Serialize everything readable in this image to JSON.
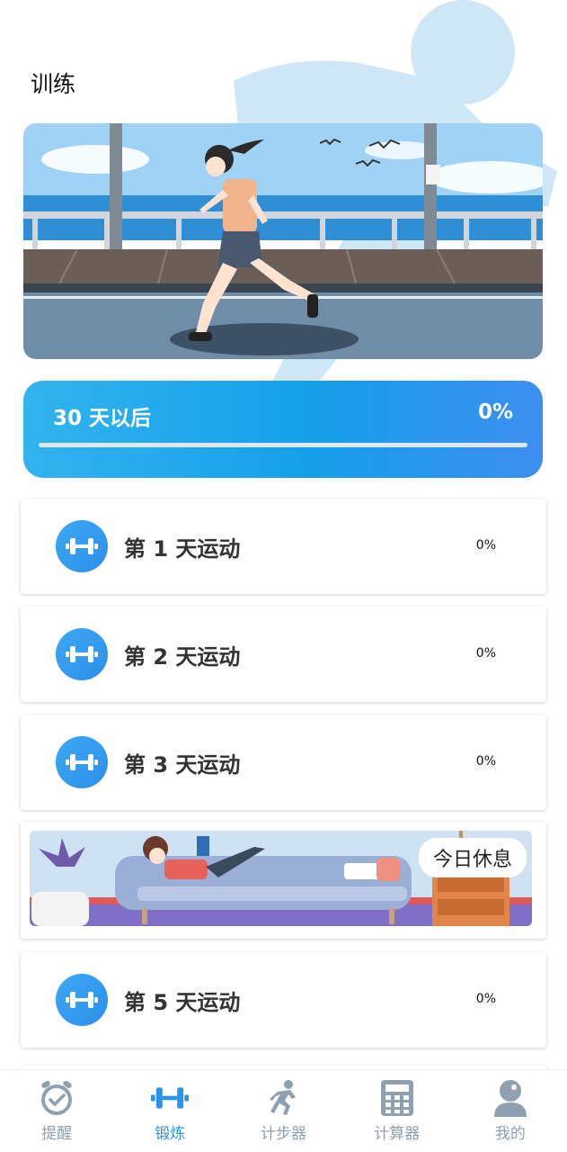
{
  "header": {
    "title": "训练"
  },
  "plan": {
    "label": "30 天以后",
    "percent_text": "0%",
    "progress": 0
  },
  "days": [
    {
      "label": "第 1 天运动",
      "percent_text": "0%"
    },
    {
      "label": "第 2 天运动",
      "percent_text": "0%"
    },
    {
      "label": "第 3 天运动",
      "percent_text": "0%"
    },
    {
      "label": "第 5 天运动",
      "percent_text": "0%"
    }
  ],
  "rest_day": {
    "label": "今日休息"
  },
  "tabbar": {
    "items": [
      {
        "label": "提醒",
        "icon": "alarm-clock-icon",
        "active": false
      },
      {
        "label": "锻炼",
        "icon": "dumbbell-icon",
        "active": true
      },
      {
        "label": "计步器",
        "icon": "runner-icon",
        "active": false
      },
      {
        "label": "计算器",
        "icon": "calculator-icon",
        "active": false
      },
      {
        "label": "我的",
        "icon": "user-profile-icon",
        "active": false
      }
    ]
  },
  "colors": {
    "accent": "#2d93e6",
    "tab_inactive": "#8fa0b0",
    "plan_gradient_start": "#33b3ef",
    "plan_gradient_end": "#3e8ef0"
  }
}
